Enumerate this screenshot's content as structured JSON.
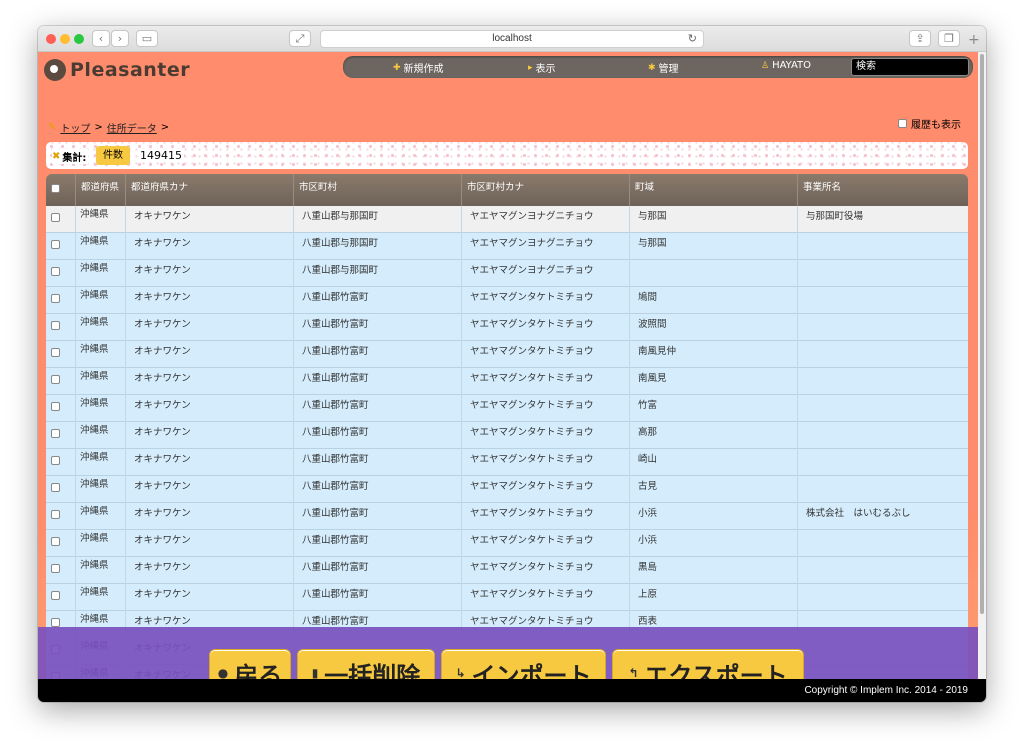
{
  "browser": {
    "url": "localhost",
    "back_icon": "chevron-left-icon",
    "forward_icon": "chevron-right-icon"
  },
  "app": {
    "logo_text": "Pleasanter",
    "nav": [
      {
        "label": "新規作成",
        "icon": "plus-icon"
      },
      {
        "label": "表示",
        "icon": "triangle-right-icon"
      },
      {
        "label": "管理",
        "icon": "gear-icon"
      },
      {
        "label": "HAYATO",
        "icon": "user-icon"
      }
    ],
    "search_placeholder": "検索",
    "breadcrumb": [
      {
        "label": "トップ"
      },
      {
        "label": "住所データ"
      }
    ],
    "breadcrumb_sep": ">",
    "history_label": "履歴も表示",
    "summary_label": "集計:",
    "count_label": "件数",
    "count_value": "149415"
  },
  "table": {
    "columns": [
      "都道府県",
      "都道府県カナ",
      "市区町村",
      "市区町村カナ",
      "町域",
      "事業所名"
    ],
    "rows": [
      [
        "沖縄県",
        "オキナワケン",
        "八重山郡与那国町",
        "ヤエヤマグンヨナグニチョウ",
        "与那国",
        "与那国町役場"
      ],
      [
        "沖縄県",
        "オキナワケン",
        "八重山郡与那国町",
        "ヤエヤマグンヨナグニチョウ",
        "与那国",
        ""
      ],
      [
        "沖縄県",
        "オキナワケン",
        "八重山郡与那国町",
        "ヤエヤマグンヨナグニチョウ",
        "",
        ""
      ],
      [
        "沖縄県",
        "オキナワケン",
        "八重山郡竹富町",
        "ヤエヤマグンタケトミチョウ",
        "鳩間",
        ""
      ],
      [
        "沖縄県",
        "オキナワケン",
        "八重山郡竹富町",
        "ヤエヤマグンタケトミチョウ",
        "波照間",
        ""
      ],
      [
        "沖縄県",
        "オキナワケン",
        "八重山郡竹富町",
        "ヤエヤマグンタケトミチョウ",
        "南風見仲",
        ""
      ],
      [
        "沖縄県",
        "オキナワケン",
        "八重山郡竹富町",
        "ヤエヤマグンタケトミチョウ",
        "南風見",
        ""
      ],
      [
        "沖縄県",
        "オキナワケン",
        "八重山郡竹富町",
        "ヤエヤマグンタケトミチョウ",
        "竹富",
        ""
      ],
      [
        "沖縄県",
        "オキナワケン",
        "八重山郡竹富町",
        "ヤエヤマグンタケトミチョウ",
        "高那",
        ""
      ],
      [
        "沖縄県",
        "オキナワケン",
        "八重山郡竹富町",
        "ヤエヤマグンタケトミチョウ",
        "崎山",
        ""
      ],
      [
        "沖縄県",
        "オキナワケン",
        "八重山郡竹富町",
        "ヤエヤマグンタケトミチョウ",
        "古見",
        ""
      ],
      [
        "沖縄県",
        "オキナワケン",
        "八重山郡竹富町",
        "ヤエヤマグンタケトミチョウ",
        "小浜",
        "株式会社　はいむるぶし"
      ],
      [
        "沖縄県",
        "オキナワケン",
        "八重山郡竹富町",
        "ヤエヤマグンタケトミチョウ",
        "小浜",
        ""
      ],
      [
        "沖縄県",
        "オキナワケン",
        "八重山郡竹富町",
        "ヤエヤマグンタケトミチョウ",
        "黒島",
        ""
      ],
      [
        "沖縄県",
        "オキナワケン",
        "八重山郡竹富町",
        "ヤエヤマグンタケトミチョウ",
        "上原",
        ""
      ],
      [
        "沖縄県",
        "オキナワケン",
        "八重山郡竹富町",
        "ヤエヤマグンタケトミチョウ",
        "西表",
        ""
      ],
      [
        "沖縄県",
        "オキナワケン",
        "",
        "",
        "",
        ""
      ],
      [
        "沖縄県",
        "オキナワケン",
        "",
        "",
        "",
        ""
      ]
    ]
  },
  "actions": [
    {
      "label": "戻る",
      "icon": "circle-icon"
    },
    {
      "label": "一括削除",
      "icon": "trash-icon"
    },
    {
      "label": "インポート",
      "icon": "import-icon"
    },
    {
      "label": "エクスポート",
      "icon": "export-icon"
    }
  ],
  "footer": {
    "copyright": "Copyright © Implem Inc. 2014 - 2019"
  },
  "colors": {
    "app_bg": "#ff8c6c",
    "accent_yellow": "#f7c940",
    "row_blue": "#d4ecfb",
    "action_bar": "#7850be"
  }
}
